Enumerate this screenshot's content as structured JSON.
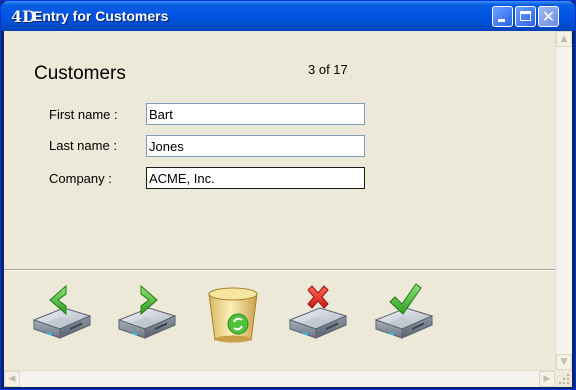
{
  "window": {
    "title": "Entry for Customers",
    "app_icon": "4D",
    "controls": [
      "minimize",
      "maximize",
      "close"
    ]
  },
  "form": {
    "heading": "Customers",
    "record_counter": "3 of 17",
    "fields": [
      {
        "label": "First name :",
        "value": "Bart"
      },
      {
        "label": "Last name :",
        "value": "Jones"
      },
      {
        "label": "Company :",
        "value": "ACME, Inc."
      }
    ]
  },
  "toolbar": {
    "buttons": [
      {
        "icon": "previous-record-icon",
        "action": "previous"
      },
      {
        "icon": "next-record-icon",
        "action": "next"
      },
      {
        "icon": "trash-recycle-icon",
        "action": "delete"
      },
      {
        "icon": "cancel-record-icon",
        "action": "cancel"
      },
      {
        "icon": "accept-record-icon",
        "action": "accept"
      }
    ]
  },
  "colors": {
    "titlebar": "#0054e3",
    "background": "#ece9d8",
    "arrow_green": "#3fb52c",
    "cancel_red": "#e8262b"
  }
}
